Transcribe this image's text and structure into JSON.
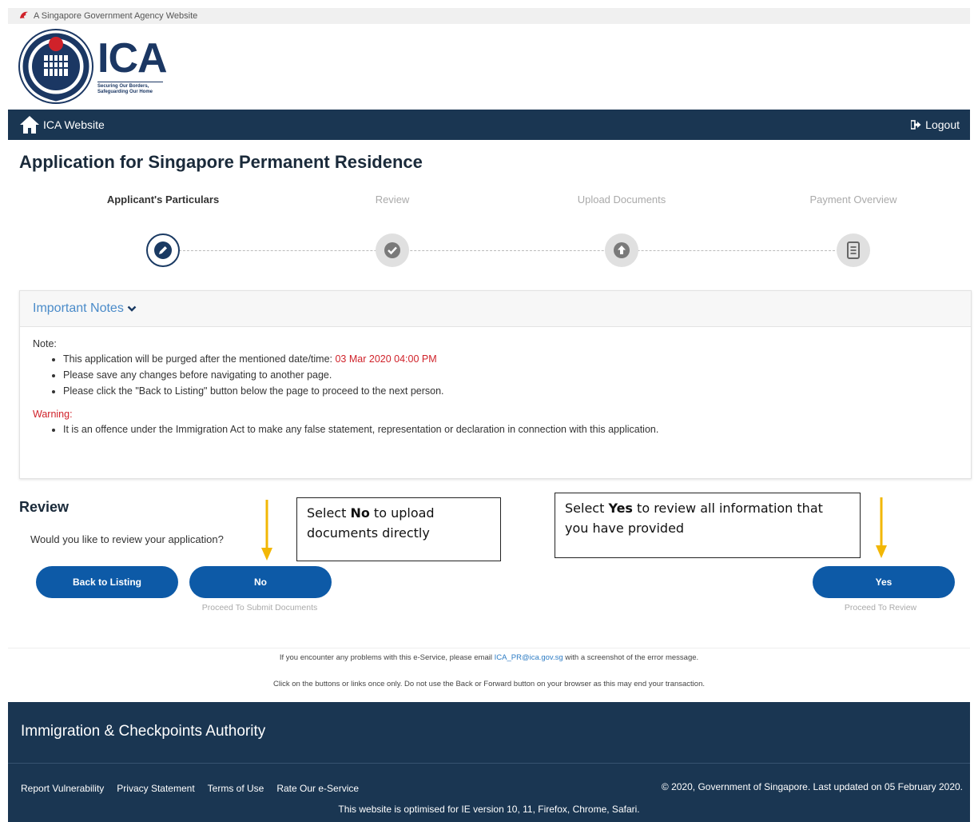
{
  "gov_banner": "A Singapore Government Agency Website",
  "logo": {
    "text": "ICA",
    "tagline_1": "Securing Our Borders,",
    "tagline_2": "Safeguarding Our Home"
  },
  "nav": {
    "home_label": "ICA Website",
    "logout_label": "Logout"
  },
  "page_title": "Application for Singapore Permanent Residence",
  "steps": [
    {
      "label": "Applicant's Particulars",
      "active": true,
      "icon": "edit-badge-icon"
    },
    {
      "label": "Review",
      "active": false,
      "icon": "check-badge-icon"
    },
    {
      "label": "Upload Documents",
      "active": false,
      "icon": "upload-badge-icon"
    },
    {
      "label": "Payment Overview",
      "active": false,
      "icon": "document-list-icon"
    }
  ],
  "notes": {
    "header": "Important Notes",
    "note_label": "Note:",
    "item_1_prefix": "This application will be purged after the mentioned date/time: ",
    "item_1_date": "03 Mar 2020 04:00 PM",
    "item_2": "Please save any changes before navigating to another page.",
    "item_3": "Please click the \"Back to Listing\" button below the page to proceed to the next person.",
    "warning_label": "Warning:",
    "warning_item": "It is an offence under the Immigration Act to make any false statement, representation or declaration in connection with this application."
  },
  "review": {
    "title": "Review",
    "question": "Would you like to review your application?",
    "back_label": "Back to Listing",
    "no_label": "No",
    "no_caption": "Proceed To Submit Documents",
    "yes_label": "Yes",
    "yes_caption": "Proceed To Review"
  },
  "callouts": {
    "no_pre": "Select ",
    "no_bold": "No",
    "no_post": " to upload documents directly",
    "yes_pre": "Select ",
    "yes_bold": "Yes",
    "yes_post": " to review all information that you have provided"
  },
  "help": {
    "line1_pre": "If you encounter any problems with this e-Service, please email ",
    "email": "ICA_PR@ica.gov.sg",
    "line1_post": " with a screenshot of the error message.",
    "line2": "Click on the buttons or links once only. Do not use the Back or Forward button on your browser as this may end your transaction."
  },
  "footer": {
    "authority": "Immigration & Checkpoints Authority",
    "links": [
      "Report Vulnerability",
      "Privacy Statement",
      "Terms of Use",
      "Rate Our e-Service"
    ],
    "copyright": "© 2020, Government of Singapore. Last updated on 05 February 2020.",
    "browsers": "This website is optimised for IE version 10, 11, Firefox, Chrome, Safari."
  },
  "colors": {
    "navy": "#1a3652",
    "button_blue": "#0d5aa7",
    "link_blue": "#4a8bc9",
    "alert_red": "#d0222a",
    "arrow_amber": "#f2b705"
  }
}
